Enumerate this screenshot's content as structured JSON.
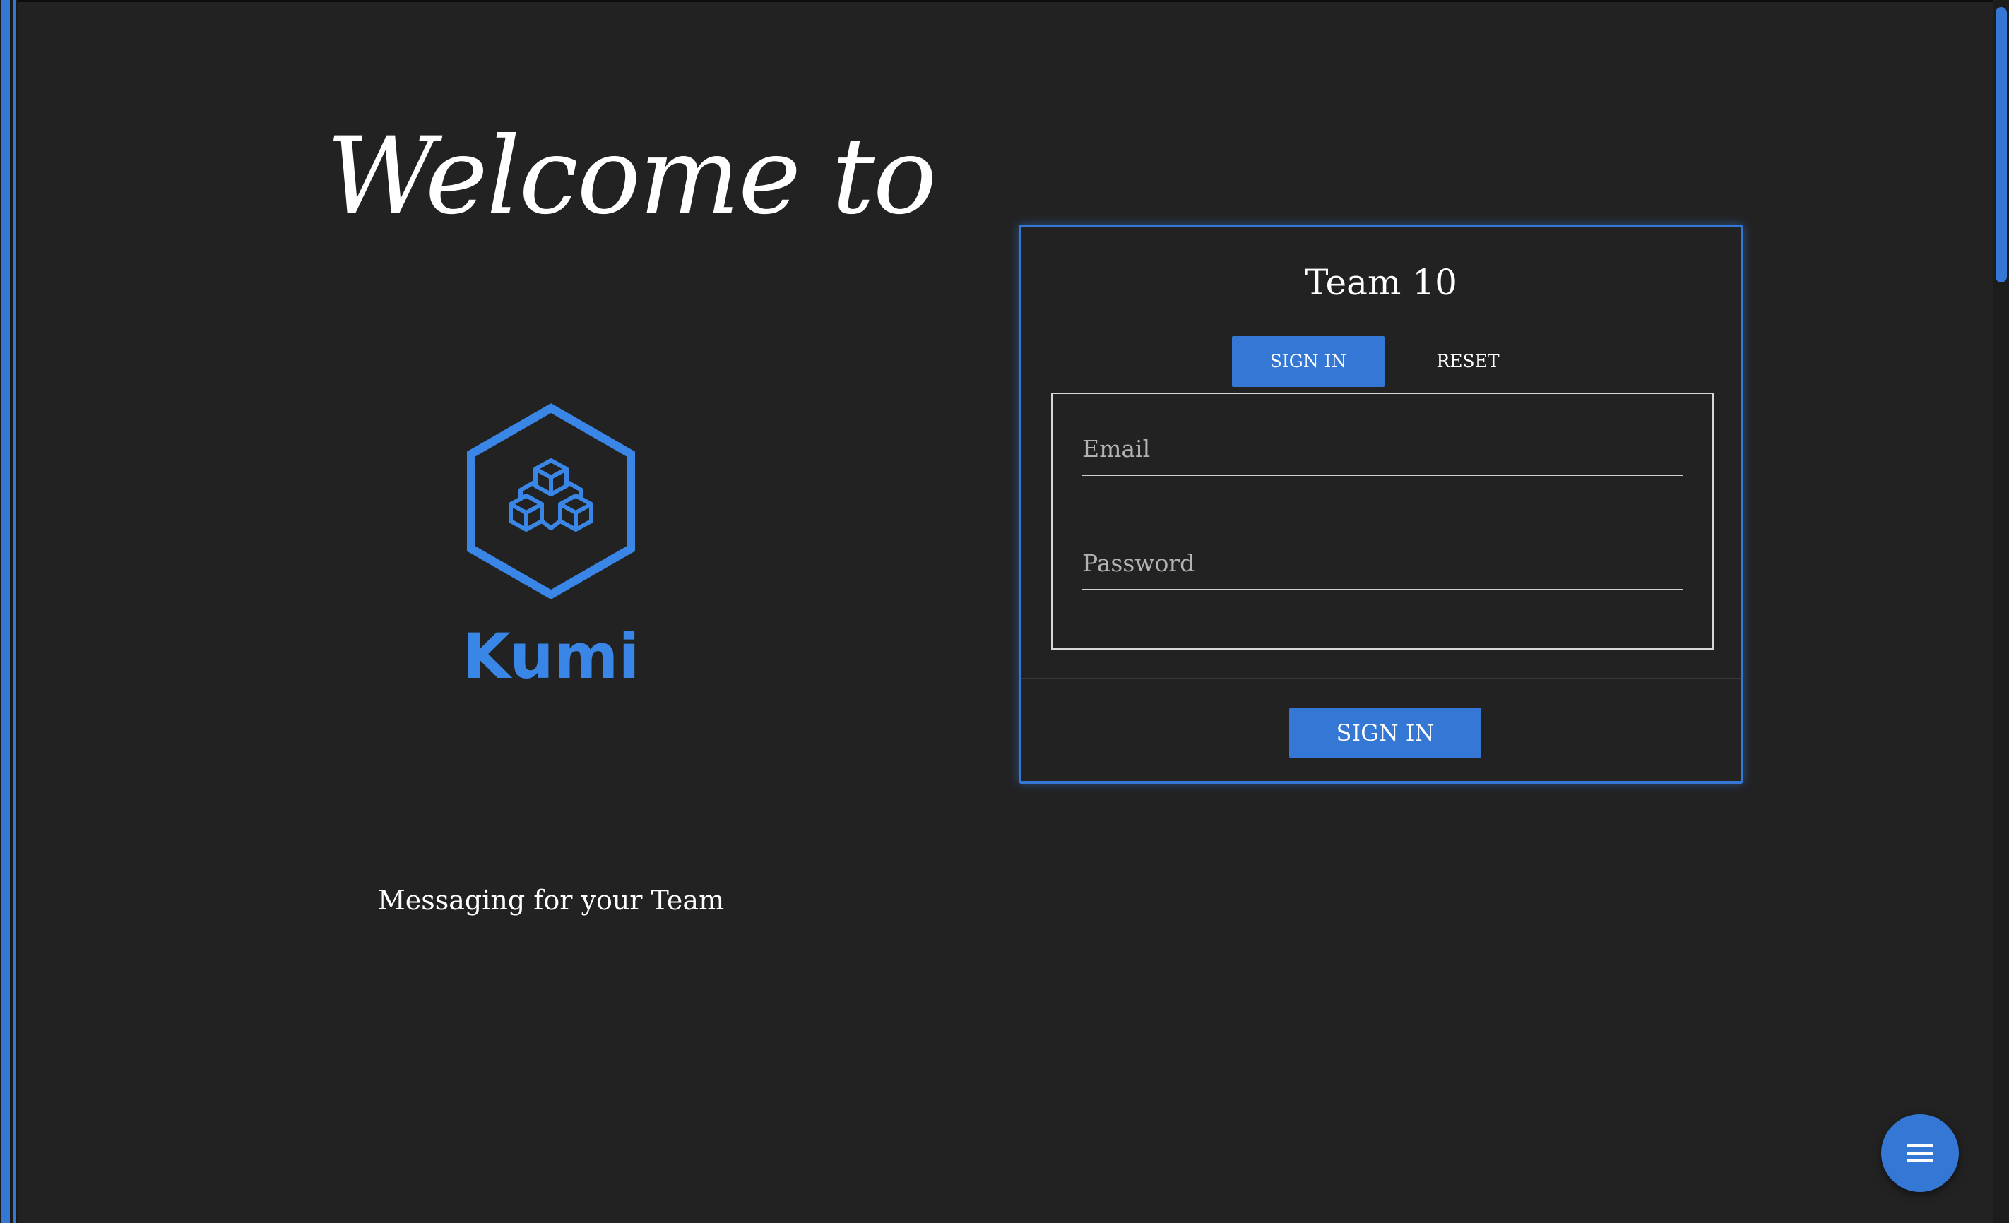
{
  "hero": {
    "welcome": "Welcome to",
    "brand": "Kumi",
    "tagline": "Messaging for your Team",
    "logo_icon": "hexagon-cubes-icon"
  },
  "login": {
    "title": "Team 10",
    "tabs": [
      {
        "label": "SIGN IN",
        "active": true
      },
      {
        "label": "RESET",
        "active": false
      }
    ],
    "email": {
      "placeholder": "Email",
      "value": ""
    },
    "password": {
      "placeholder": "Password",
      "value": ""
    },
    "submit_label": "SIGN IN"
  },
  "fab": {
    "icon": "menu-icon"
  },
  "colors": {
    "background": "#222222",
    "accent": "#3577d4",
    "brand": "#3a86e6",
    "text": "#ffffff"
  }
}
